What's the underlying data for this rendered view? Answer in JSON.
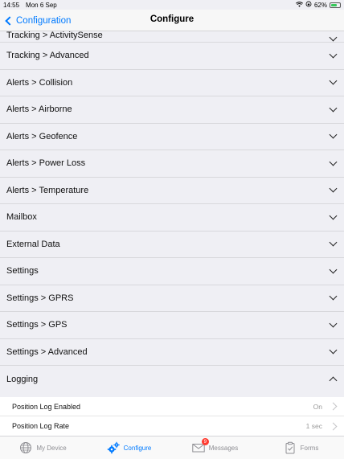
{
  "status_bar": {
    "time": "14:55",
    "date": "Mon 6 Sep",
    "battery": "62%"
  },
  "nav": {
    "back_label": "Configuration",
    "title": "Configure"
  },
  "sections": [
    {
      "label": "Tracking > ActivitySense",
      "expanded": false
    },
    {
      "label": "Tracking > Advanced",
      "expanded": false
    },
    {
      "label": "Alerts > Collision",
      "expanded": false
    },
    {
      "label": "Alerts > Airborne",
      "expanded": false
    },
    {
      "label": "Alerts > Geofence",
      "expanded": false
    },
    {
      "label": "Alerts > Power Loss",
      "expanded": false
    },
    {
      "label": "Alerts > Temperature",
      "expanded": false
    },
    {
      "label": "Mailbox",
      "expanded": false
    },
    {
      "label": "External Data",
      "expanded": false
    },
    {
      "label": "Settings",
      "expanded": false
    },
    {
      "label": "Settings > GPRS",
      "expanded": false
    },
    {
      "label": "Settings > GPS",
      "expanded": false
    },
    {
      "label": "Settings > Advanced",
      "expanded": false
    },
    {
      "label": "Logging",
      "expanded": true
    }
  ],
  "logging_items": [
    {
      "label": "Position Log Enabled",
      "value": "On"
    },
    {
      "label": "Position Log Rate",
      "value": "1 sec"
    }
  ],
  "tabs": [
    {
      "label": "My Device",
      "icon": "globe-icon",
      "active": false
    },
    {
      "label": "Configure",
      "icon": "gears-icon",
      "active": true
    },
    {
      "label": "Messages",
      "icon": "envelope-icon",
      "active": false,
      "badge": "9"
    },
    {
      "label": "Forms",
      "icon": "clipboard-icon",
      "active": false
    }
  ],
  "colors": {
    "accent": "#007aff",
    "badge": "#ff3b30",
    "background": "#efeff4"
  }
}
